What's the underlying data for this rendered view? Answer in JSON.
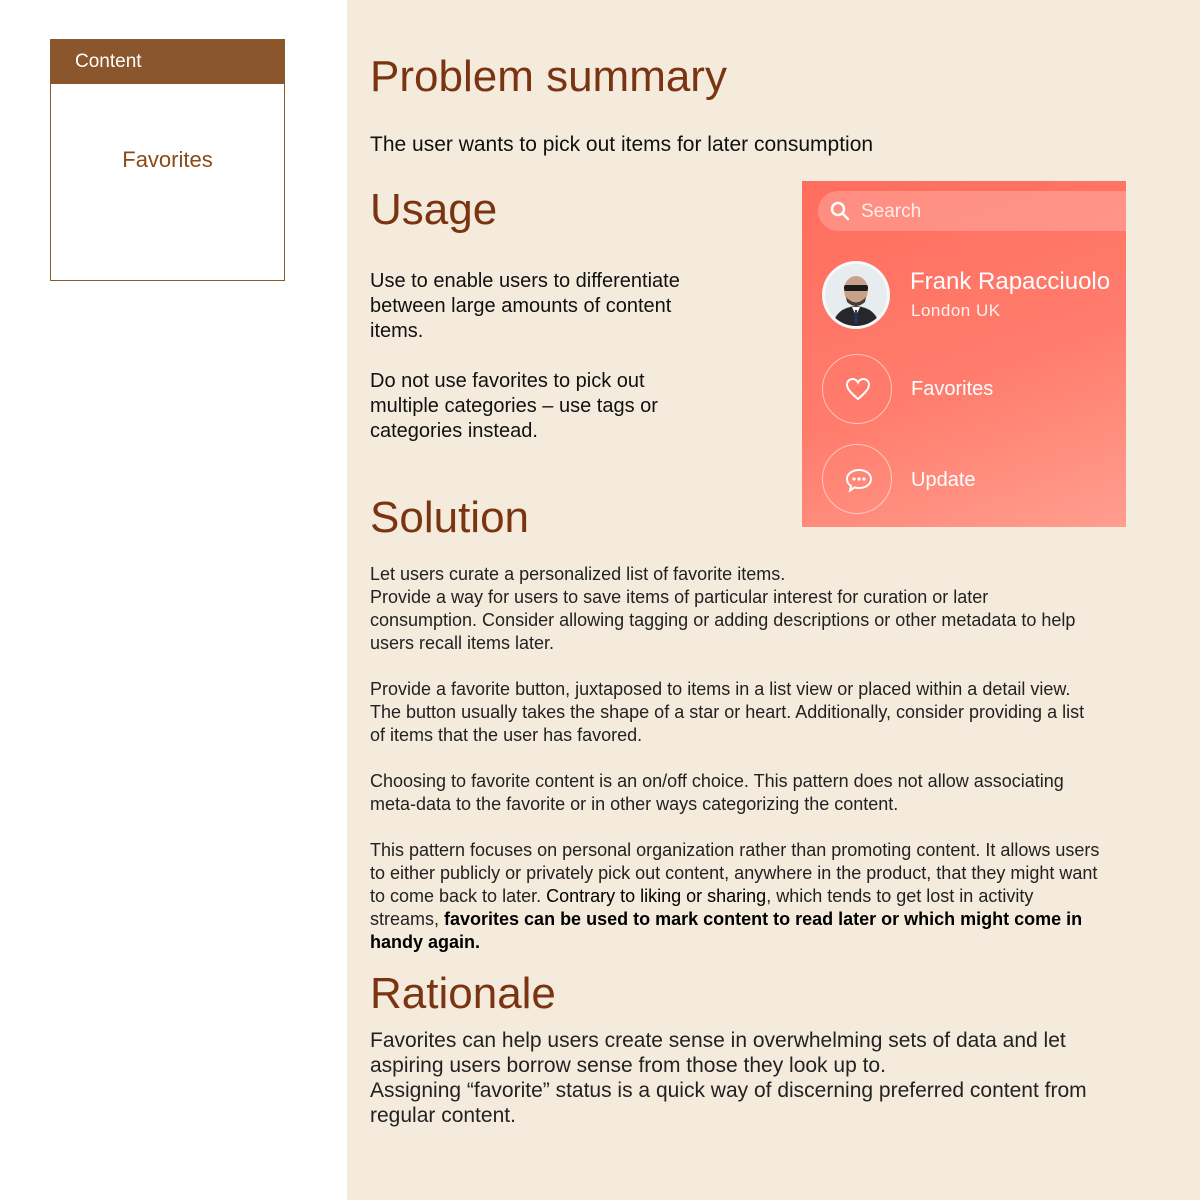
{
  "sidebar": {
    "card_header": "Content",
    "card_item": "Favorites"
  },
  "problem": {
    "heading": "Problem summary",
    "text": "The user wants to pick out items for later consumption"
  },
  "usage": {
    "heading": "Usage",
    "para1": "Use to enable users to differentiate between large amounts of content items.",
    "para2": "Do not use favorites to pick out multiple categories – use tags or categories instead."
  },
  "app_mock": {
    "search_placeholder": "Search",
    "user_name": "Frank Rapacciuolo",
    "user_location": "London UK",
    "menu": [
      {
        "label": "Favorites",
        "icon": "heart-icon"
      },
      {
        "label": "Update",
        "icon": "chat-bubble-icon"
      }
    ]
  },
  "solution": {
    "heading": "Solution",
    "p1_line1": "Let users curate a personalized list of favorite items.",
    "p1_line2": "Provide a way for users to save items of particular interest for curation or later consumption. Consider allowing tagging or adding descriptions or other metadata to help users recall items later.",
    "p2": "Provide a favorite button, juxtaposed to items in a list view or placed within a detail view. The button usually takes the shape of a star or heart. Additionally, consider providing a list of items that the user has favored.",
    "p3": "Choosing to favorite content is an on/off choice. This pattern does not allow associating meta-data to the favorite or in other ways categorizing the content.",
    "p4_a": "This pattern focuses on personal organization rather than promoting content. It allows users to either publicly or privately pick out content, anywhere in the product, that they might want to come back to later. ",
    "p4_b": "Contrary to liking or sharing",
    "p4_c": ", which tends to get lost in activity streams, ",
    "p4_bold": "favorites can be used to mark content to read later or which might come in handy again."
  },
  "rationale": {
    "heading": "Rationale",
    "line1": "Favorites can help users create sense in overwhelming sets of data and let aspiring users borrow sense from those they look up to.",
    "line2": "Assigning “favorite” status is a quick way of discerning preferred content from regular content."
  }
}
